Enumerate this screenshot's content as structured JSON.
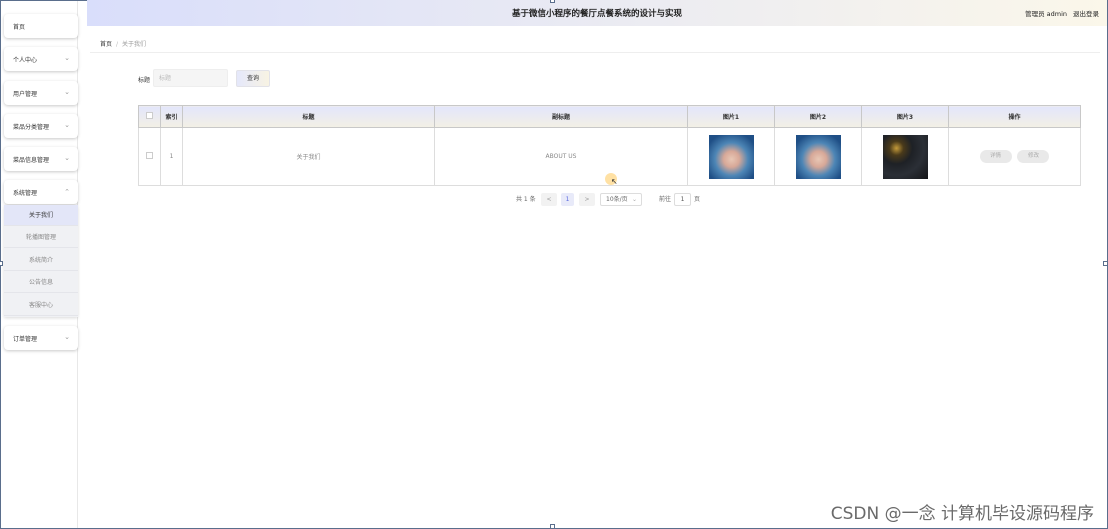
{
  "header": {
    "title": "基于微信小程序的餐厅点餐系统的设计与实现",
    "user": "管理员 admin",
    "logout": "退出登录"
  },
  "sidebar": {
    "items": [
      {
        "label": "首页",
        "expandable": false
      },
      {
        "label": "个人中心",
        "expandable": true
      },
      {
        "label": "用户管理",
        "expandable": true
      },
      {
        "label": "菜品分类管理",
        "expandable": true
      },
      {
        "label": "菜品信息管理",
        "expandable": true
      },
      {
        "label": "系统管理",
        "expandable": true,
        "expanded": true
      },
      {
        "label": "订单管理",
        "expandable": true
      }
    ],
    "submenu": [
      {
        "label": "关于我们",
        "active": true
      },
      {
        "label": "轮播图管理"
      },
      {
        "label": "系统简介"
      },
      {
        "label": "公告信息"
      },
      {
        "label": "客服中心"
      }
    ]
  },
  "breadcrumb": {
    "home": "首页",
    "separator": "/",
    "current": "关于我们"
  },
  "search": {
    "label": "标题",
    "placeholder": "标题",
    "button": "查询"
  },
  "table": {
    "headers": [
      "索引",
      "标题",
      "副标题",
      "图片1",
      "图片2",
      "图片3",
      "操作"
    ],
    "rows": [
      {
        "index": "1",
        "title": "关于我们",
        "subtitle": "ABOUT US",
        "actions": [
          "详情",
          "修改"
        ]
      }
    ]
  },
  "pagination": {
    "total": "共 1 条",
    "prev": "<",
    "current_page": "1",
    "next": ">",
    "page_size": "10条/页",
    "goto_prefix": "前往",
    "goto_value": "1",
    "goto_suffix": "页"
  },
  "watermark": "CSDN @一念 计算机毕设源码程序",
  "colors": {
    "header_gradient_start": "#d9defb",
    "header_gradient_end": "#fbf7ea",
    "active_submenu": "#e3e6f8",
    "pager_active_text": "#5b6be0"
  }
}
